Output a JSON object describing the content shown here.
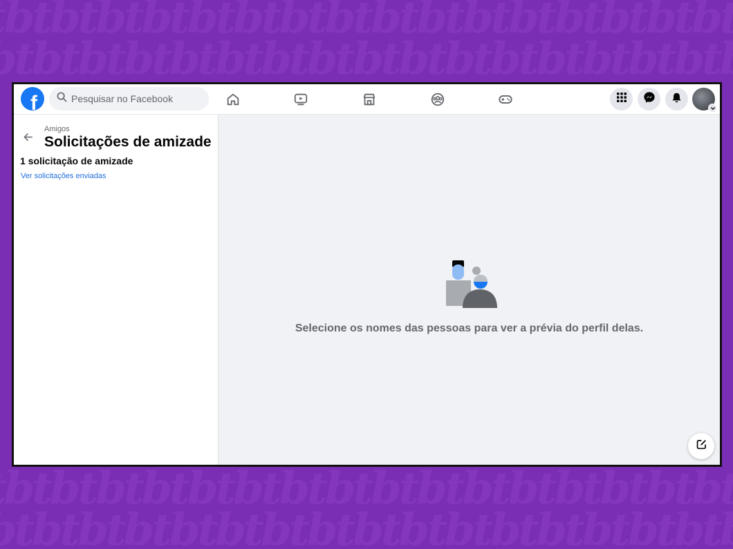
{
  "colors": {
    "brand": "#1877f2",
    "link": "#216fdb",
    "background_purple": "#7a2eb4"
  },
  "background": {
    "pattern_text": "tbtbtbtbtbtbtbtbtbtbtbtbtbtbtbtbtbtb"
  },
  "header": {
    "logo_letter": "f",
    "search": {
      "placeholder": "Pesquisar no Facebook",
      "icon": "search-icon"
    },
    "nav": [
      {
        "name": "home",
        "icon": "home-icon"
      },
      {
        "name": "watch",
        "icon": "video-icon"
      },
      {
        "name": "marketplace",
        "icon": "store-icon"
      },
      {
        "name": "groups",
        "icon": "groups-icon"
      },
      {
        "name": "gaming",
        "icon": "gamepad-icon"
      }
    ],
    "right": [
      {
        "name": "menu",
        "icon": "grid-icon"
      },
      {
        "name": "messenger",
        "icon": "messenger-icon"
      },
      {
        "name": "notifications",
        "icon": "bell-icon"
      },
      {
        "name": "account",
        "icon": "avatar"
      }
    ]
  },
  "sidebar": {
    "breadcrumb": "Amigos",
    "title": "Solicitações de amizade",
    "request_count": "1 solicitação de amizade",
    "sent_link": "Ver solicitações enviadas"
  },
  "main": {
    "empty_message": "Selecione os nomes das pessoas para ver a prévia do perfil delas."
  }
}
